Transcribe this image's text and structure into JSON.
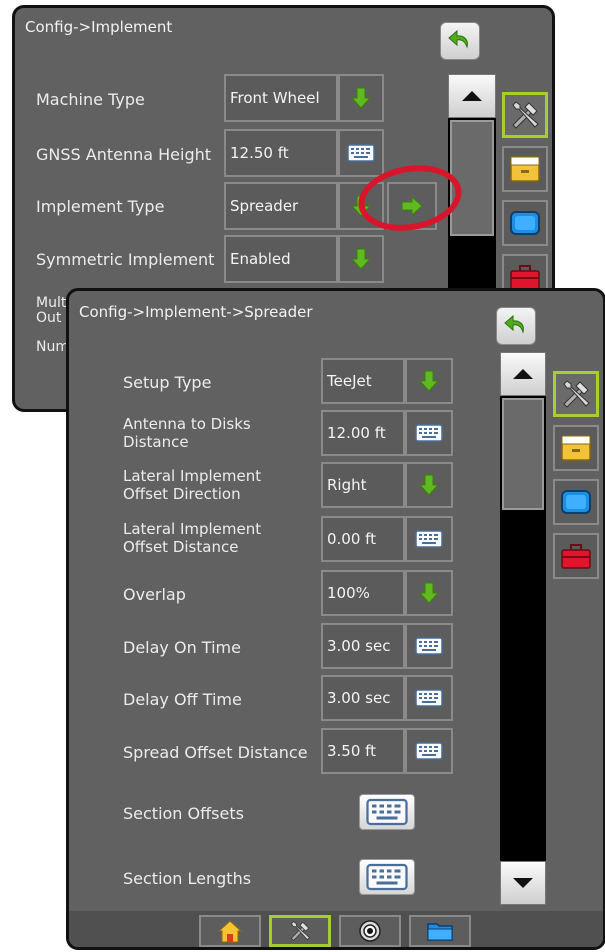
{
  "back_panel": {
    "title": "Config->Implement",
    "rows": [
      {
        "label": "Machine Type",
        "value": "Front Wheel"
      },
      {
        "label": "GNSS Antenna Height",
        "value": "12.50 ft"
      },
      {
        "label": "Implement Type",
        "value": "Spreader"
      },
      {
        "label": "Symmetric Implement",
        "value": "Enabled"
      }
    ],
    "partial_label_a1": "Mult",
    "partial_label_a2": "Out",
    "partial_label_b": "Num"
  },
  "front_panel": {
    "title": "Config->Implement->Spreader",
    "rows": [
      {
        "label": "Setup Type",
        "value": "TeeJet"
      },
      {
        "label1": "Antenna to Disks",
        "label2": "Distance",
        "value": "12.00 ft"
      },
      {
        "label1": "Lateral Implement",
        "label2": "Offset Direction",
        "value": "Right"
      },
      {
        "label1": "Lateral Implement",
        "label2": "Offset Distance",
        "value": "0.00 ft"
      },
      {
        "label": "Overlap",
        "value": "100%"
      },
      {
        "label": "Delay On Time",
        "value": "3.00 sec"
      },
      {
        "label": "Delay Off Time",
        "value": "3.00 sec"
      },
      {
        "label": "Spread Offset Distance",
        "value": "3.50 ft"
      },
      {
        "label": "Section Offsets"
      },
      {
        "label": "Section Lengths"
      }
    ]
  },
  "icons": {
    "back": "back-arrow-icon",
    "dropdown": "green-down-arrow-icon",
    "next": "green-right-arrow-icon",
    "keyboard": "keyboard-icon",
    "tools": "tools-icon",
    "storage": "drawer-icon",
    "console": "console-icon",
    "toolbox": "toolbox-icon",
    "home": "home-icon",
    "gnss": "gnss-icon",
    "data": "data-icon"
  },
  "colors": {
    "panel_bg": "#616161",
    "active_green": "#a6cf2b",
    "arrow_green": "#5fb91f",
    "highlight_red": "#d8152a"
  }
}
